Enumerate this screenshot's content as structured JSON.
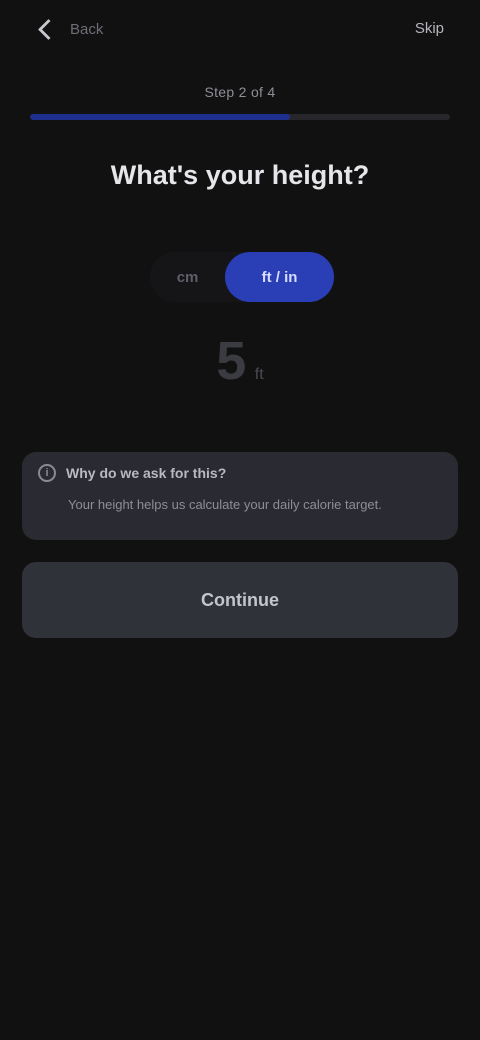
{
  "topbar": {
    "back_label": "Back",
    "skip_label": "Skip"
  },
  "progress": {
    "step_label": "Step 2 of 4",
    "value": 0.62
  },
  "title": "What's your height?",
  "unit_toggle": {
    "options": [
      {
        "label": "cm",
        "active": false
      },
      {
        "label": "ft / in",
        "active": true
      }
    ]
  },
  "value_display": {
    "number": "5",
    "unit": "ft"
  },
  "info_card": {
    "heading": "Why do we ask for this?",
    "text": "Your height helps us calculate your daily calorie target."
  },
  "continue_button": {
    "label": "Continue"
  },
  "colors": {
    "background": "#111112",
    "accent": "#2a3fb6",
    "card": "#2a2b32"
  }
}
